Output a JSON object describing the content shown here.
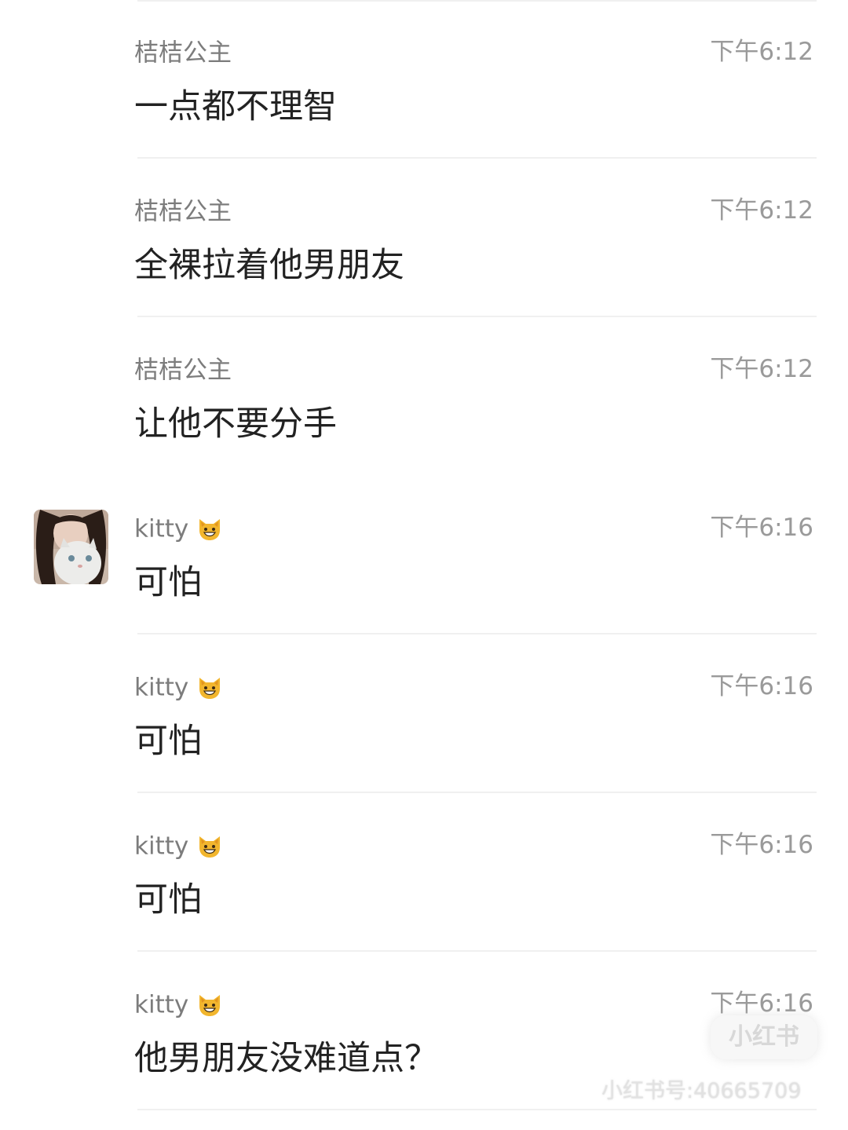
{
  "messages": [
    {
      "sender": "桔桔公主",
      "time": "下午6:12",
      "text": "一点都不理智"
    },
    {
      "sender": "桔桔公主",
      "time": "下午6:12",
      "text": "全裸拉着他男朋友"
    },
    {
      "sender": "桔桔公主",
      "time": "下午6:12",
      "text": "让他不要分手"
    },
    {
      "sender": "kitty",
      "sender_emoji": "grinning-cat-emoji",
      "time": "下午6:16",
      "text": "可怕"
    },
    {
      "sender": "kitty",
      "sender_emoji": "grinning-cat-emoji",
      "time": "下午6:16",
      "text": "可怕"
    },
    {
      "sender": "kitty",
      "sender_emoji": "grinning-cat-emoji",
      "time": "下午6:16",
      "text": "可怕"
    },
    {
      "sender": "kitty",
      "sender_emoji": "grinning-cat-emoji",
      "time": "下午6:16",
      "text": "他男朋友没难道点？"
    }
  ],
  "watermark": {
    "logo_text": "小红书",
    "account_text": "小红书号:40665709"
  },
  "colors": {
    "background": "#ffffff",
    "sender_text": "#7c7c7c",
    "time_text": "#9a9a9a",
    "message_text": "#222222",
    "divider": "#f0f0f0"
  }
}
